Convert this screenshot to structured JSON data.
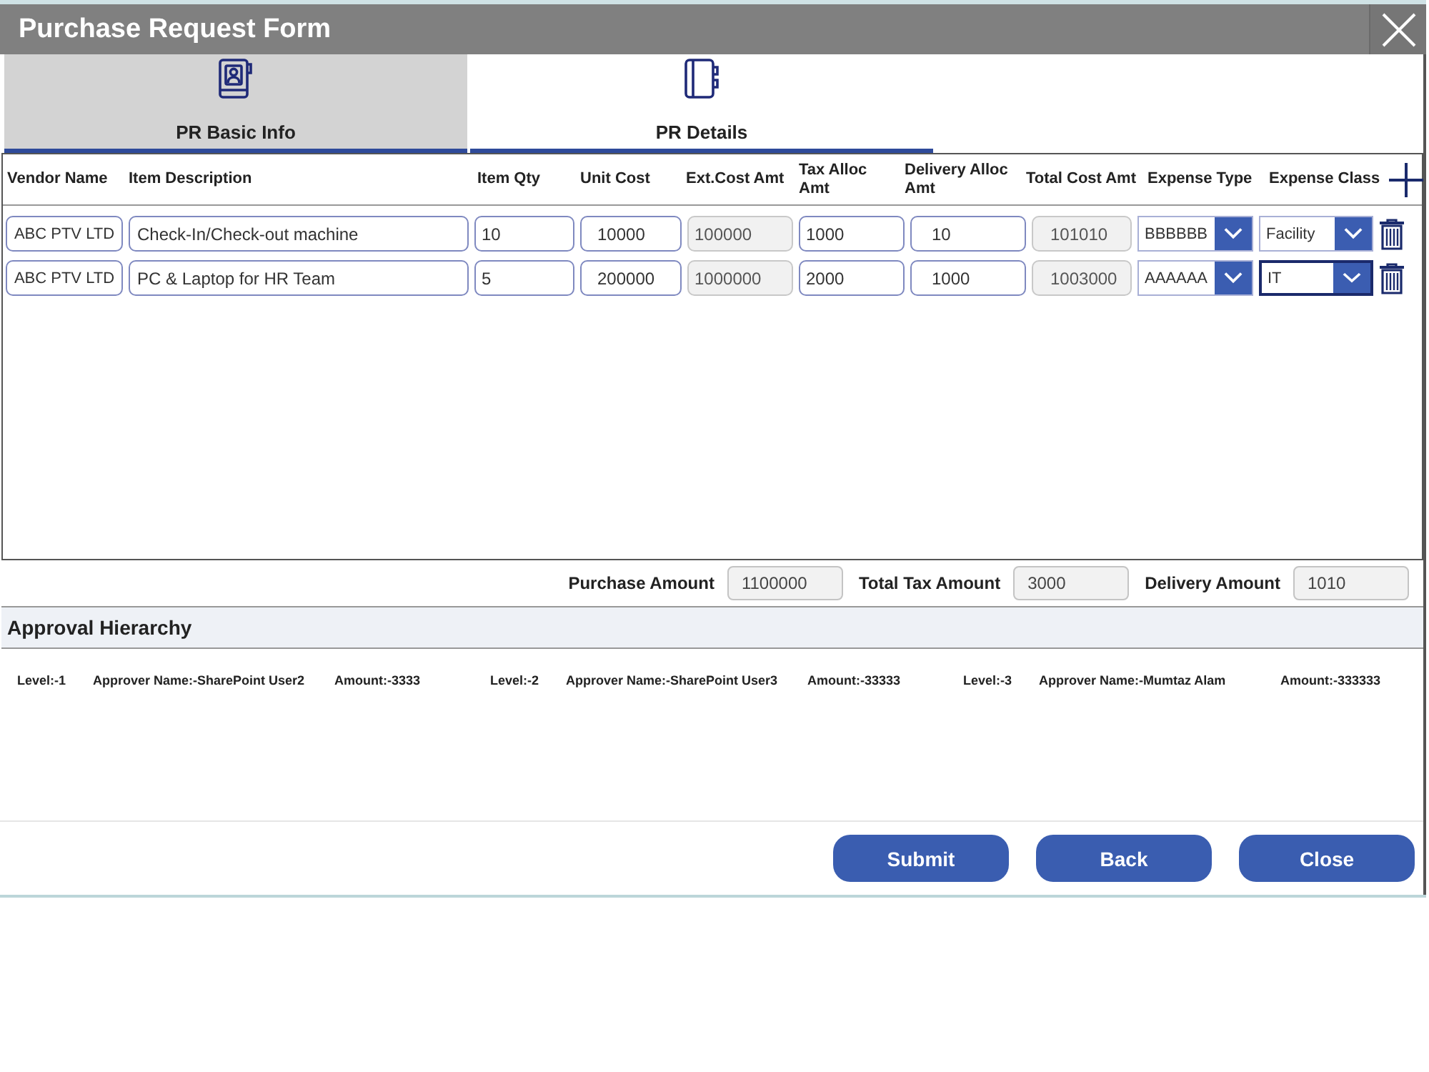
{
  "window": {
    "title": "Purchase Request Form"
  },
  "tabs": [
    {
      "label": "PR Basic Info",
      "selected": true
    },
    {
      "label": "PR Details",
      "selected": false
    }
  ],
  "table": {
    "columns": [
      "Vendor Name",
      "Item Description",
      "Item Qty",
      "Unit Cost",
      "Ext.Cost Amt",
      "Tax Alloc Amt",
      "Delivery Alloc Amt",
      "Total Cost Amt",
      "Expense Type",
      "Expense Class"
    ],
    "rows": [
      {
        "cells": [
          {
            "kind": "input",
            "value": "ABC PTV LTD"
          },
          {
            "kind": "input",
            "value": "Check-In/Check-out machine"
          },
          {
            "kind": "input",
            "value": "10"
          },
          {
            "kind": "input",
            "value": "10000"
          },
          {
            "kind": "readonly",
            "value": "100000"
          },
          {
            "kind": "input",
            "value": "1000"
          },
          {
            "kind": "input",
            "value": "10"
          },
          {
            "kind": "readonly",
            "value": "101010"
          },
          {
            "kind": "dropdown",
            "value": "BBBBBB",
            "focused": false
          },
          {
            "kind": "dropdown",
            "value": "Facility",
            "focused": false
          }
        ]
      },
      {
        "cells": [
          {
            "kind": "input",
            "value": "ABC PTV LTD"
          },
          {
            "kind": "input",
            "value": "PC & Laptop for HR Team"
          },
          {
            "kind": "input",
            "value": "5"
          },
          {
            "kind": "input",
            "value": "200000"
          },
          {
            "kind": "readonly",
            "value": "1000000"
          },
          {
            "kind": "input",
            "value": "2000"
          },
          {
            "kind": "input",
            "value": "1000"
          },
          {
            "kind": "readonly",
            "value": "1003000"
          },
          {
            "kind": "dropdown",
            "value": "AAAAAA",
            "focused": false
          },
          {
            "kind": "dropdown",
            "value": "IT",
            "focused": true
          }
        ]
      }
    ]
  },
  "totals": [
    {
      "label": "Purchase Amount",
      "value": "1100000"
    },
    {
      "label": "Total Tax Amount",
      "value": "3000"
    },
    {
      "label": "Delivery Amount",
      "value": "1010"
    }
  ],
  "approval": {
    "title": "Approval Hierarchy",
    "approvers": [
      {
        "level": "Level:-1",
        "name": "Approver Name:-SharePoint User2",
        "amount": "Amount:-3333"
      },
      {
        "level": "Level:-2",
        "name": "Approver Name:-SharePoint User3",
        "amount": "Amount:-33333"
      },
      {
        "level": "Level:-3",
        "name": "Approver Name:-Mumtaz Alam",
        "amount": "Amount:-333333"
      }
    ]
  },
  "buttons": [
    "Submit",
    "Back",
    "Close"
  ]
}
